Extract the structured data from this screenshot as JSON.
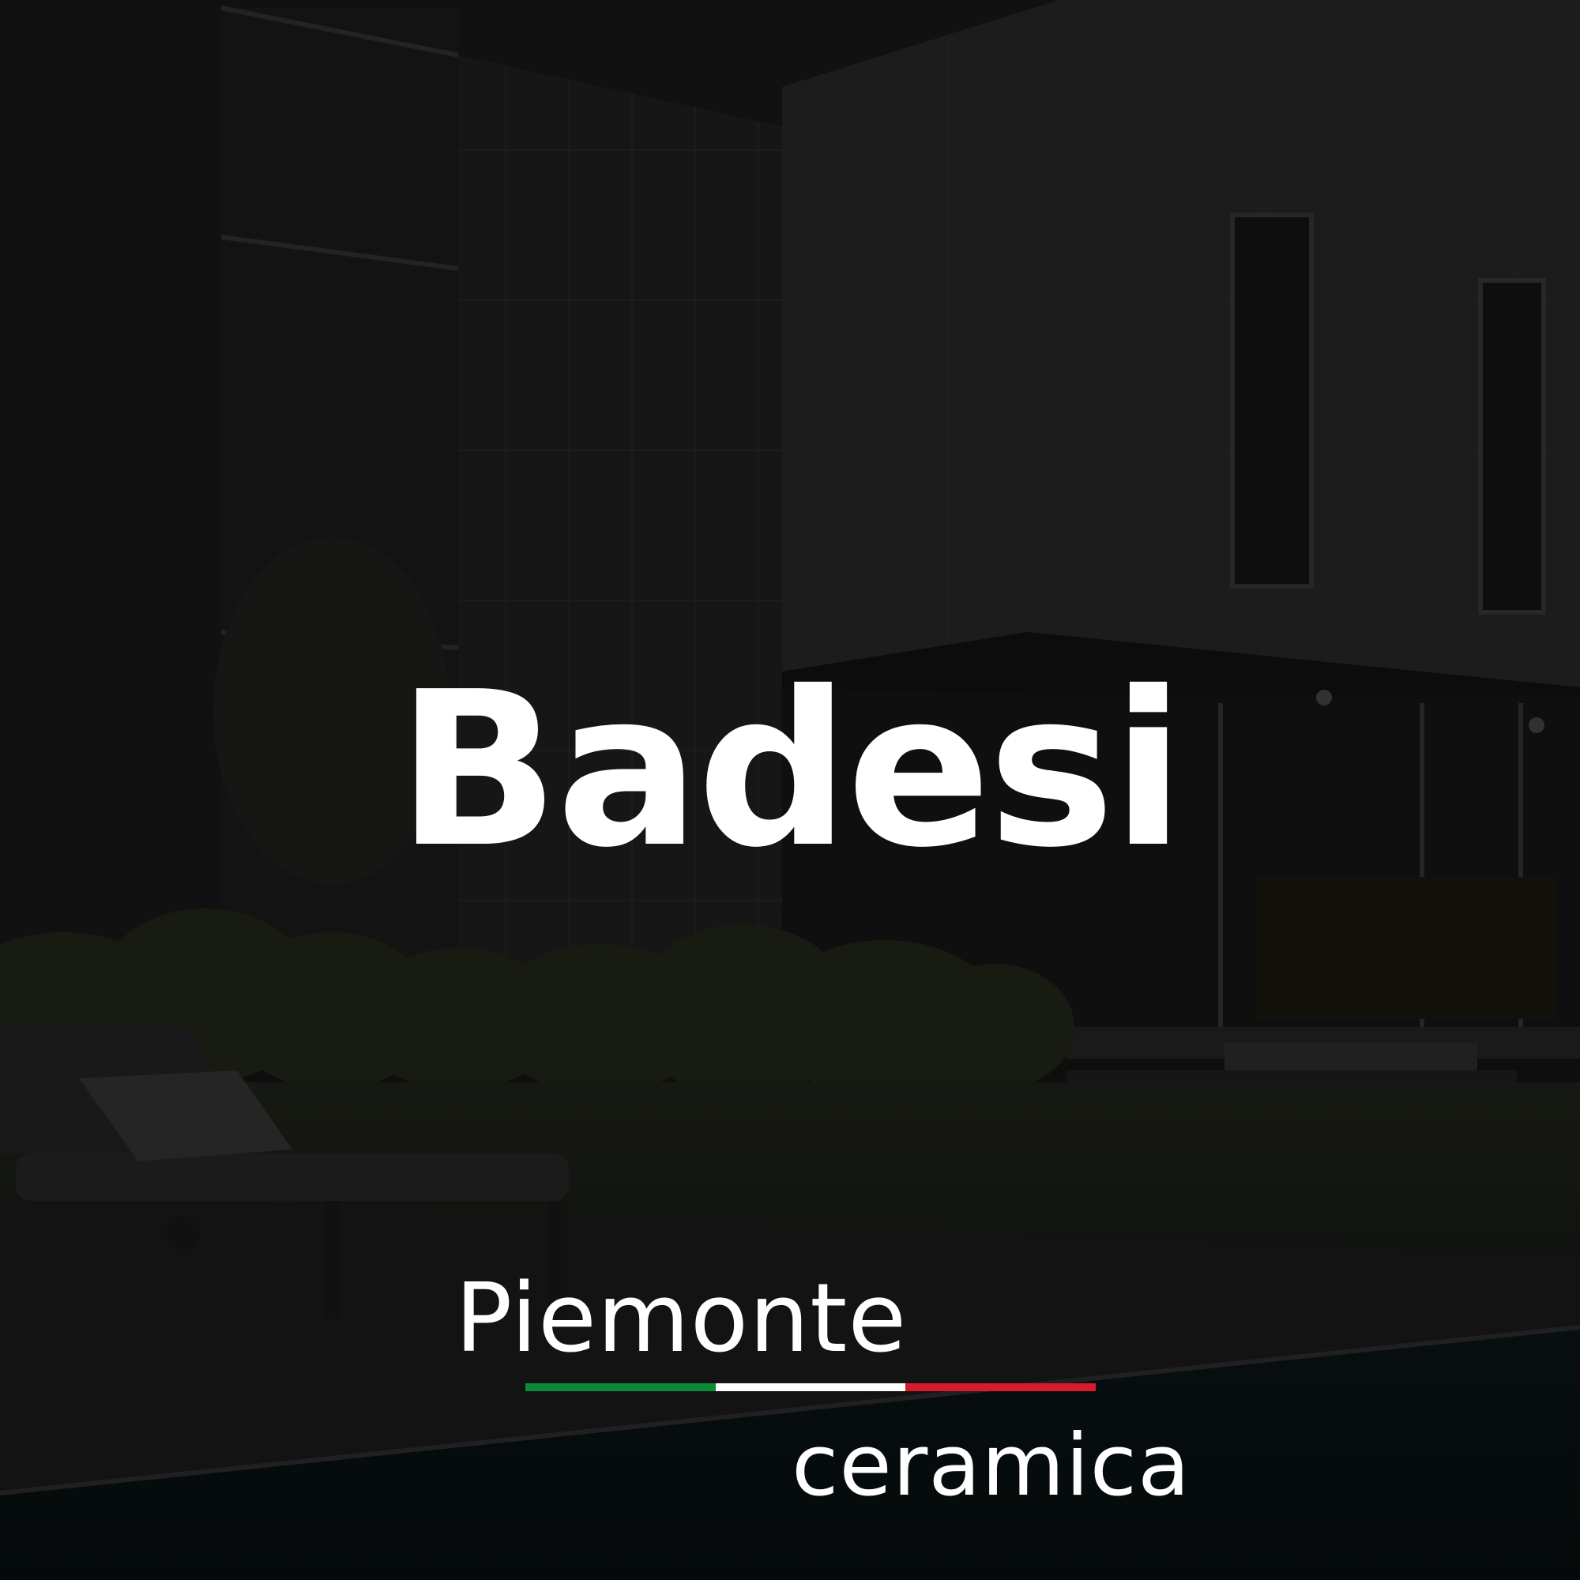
{
  "title": "Badesi",
  "brand": {
    "line1": "Piemonte",
    "line2": "ceramica",
    "flag_colors": [
      "#0b8a3a",
      "#ffffff",
      "#d81b2c"
    ]
  },
  "background": {
    "description_icon": "house-exterior-night-photo",
    "overlay_color": "#0d0d0d"
  }
}
